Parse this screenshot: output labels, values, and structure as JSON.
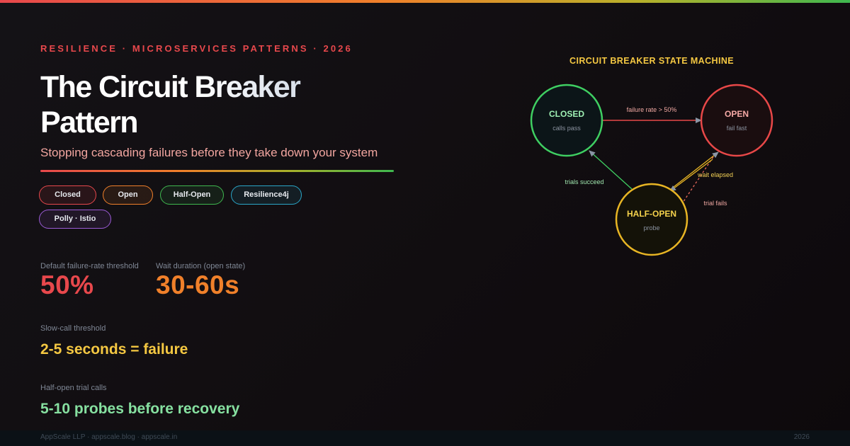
{
  "header": {
    "eyebrow": "RESILIENCE · MICROSERVICES PATTERNS · 2026",
    "title": "The Circuit Breaker Pattern",
    "subtitle": "Stopping cascading failures before they take down your system"
  },
  "tags": [
    {
      "label": "Closed",
      "color": "#e8484c"
    },
    {
      "label": "Open",
      "color": "#f0802a"
    },
    {
      "label": "Half-Open",
      "color": "#3fb84f"
    },
    {
      "label": "Resilience4j",
      "color": "#2aa6c8"
    },
    {
      "label": "Polly · Istio",
      "color": "#9b5bd6"
    }
  ],
  "stats": {
    "failure_threshold": {
      "label": "Default failure-rate threshold",
      "value": "50%",
      "color": "#e8484c"
    },
    "wait_duration": {
      "label": "Wait duration (open state)",
      "value": "30-60s",
      "color": "#f0802a"
    },
    "slow_call": {
      "label": "Slow-call threshold",
      "value": "2-5 seconds = failure",
      "color": "#f5c842"
    },
    "trial_calls": {
      "label": "Half-open trial calls",
      "value": "5-10 probes before recovery",
      "color": "#86e0a0"
    }
  },
  "diagram": {
    "title": "CIRCUIT BREAKER STATE MACHINE",
    "states": {
      "closed": {
        "name": "CLOSED",
        "sub": "calls pass",
        "color": "#3fcf62",
        "text": "#9ff0b4"
      },
      "open": {
        "name": "OPEN",
        "sub": "fail fast",
        "color": "#e84848",
        "text": "#f6a9a6"
      },
      "half_open": {
        "name": "HALF-OPEN",
        "sub": "probe",
        "color": "#e8b524",
        "text": "#f5d24c"
      }
    },
    "transitions": {
      "failure_rate": "failure rate > 50%",
      "trials_succeed": "trials succeed",
      "wait_elapsed": "wait elapsed",
      "trial_fails": "trial fails"
    }
  },
  "footer": {
    "left": "AppScale LLP · appscale.blog · appscale.in",
    "right": "2026"
  }
}
